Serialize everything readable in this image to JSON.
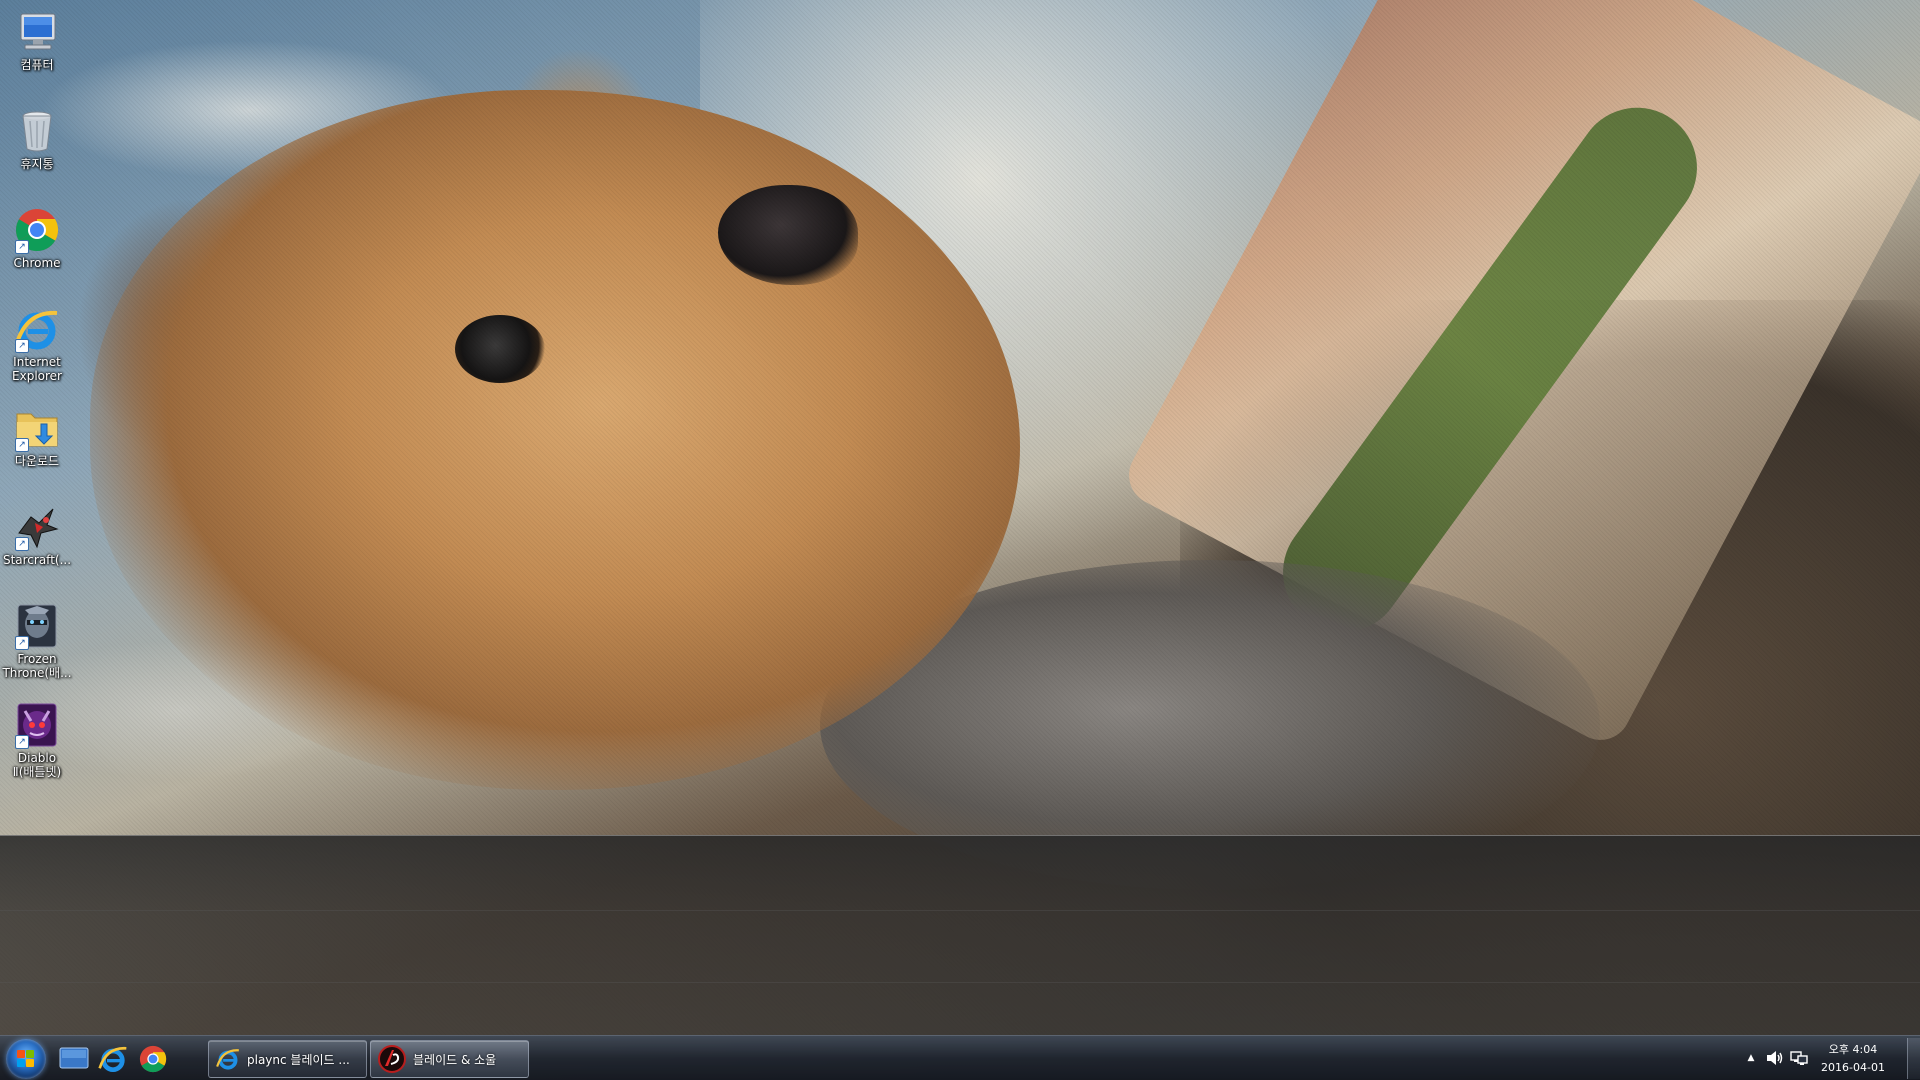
{
  "desktop": {
    "icons": [
      {
        "label": "컴퓨터",
        "icon": "computer-icon",
        "shortcut": false
      },
      {
        "label": "휴지통",
        "icon": "recycle-bin-icon",
        "shortcut": false
      },
      {
        "label": "Chrome",
        "icon": "chrome-icon",
        "shortcut": true
      },
      {
        "label": "Internet Explorer",
        "icon": "internet-explorer-icon",
        "shortcut": true
      },
      {
        "label": "다운로드",
        "icon": "downloads-folder-icon",
        "shortcut": true
      },
      {
        "label": "Starcraft(...",
        "icon": "starcraft-icon",
        "shortcut": true
      },
      {
        "label": "Frozen Throne(배...",
        "icon": "frozen-throne-icon",
        "shortcut": true
      },
      {
        "label": "Diablo Ⅱ(배틀넷)",
        "icon": "diablo-icon",
        "shortcut": true
      }
    ]
  },
  "taskbar": {
    "pinned": [
      {
        "name": "show-desktop-pin",
        "icon": "desktop-icon"
      },
      {
        "name": "internet-explorer-pin",
        "icon": "internet-explorer-icon"
      },
      {
        "name": "chrome-pin",
        "icon": "chrome-icon"
      }
    ],
    "windows": [
      {
        "label": "plaync 블레이드 ...",
        "icon": "internet-explorer-icon",
        "active": false
      },
      {
        "label": "블레이드 & 소울",
        "icon": "blade-and-soul-icon",
        "active": true
      }
    ],
    "tray": {
      "show_hidden_glyph": "▲",
      "volume_icon": "speaker-icon",
      "network_icon": "network-icon"
    },
    "clock": {
      "time": "오후 4:04",
      "date": "2016-04-01"
    }
  },
  "colors": {
    "taskbar_bg": "#1e2430",
    "ie_blue": "#1e90e6",
    "chrome_red": "#db4437",
    "chrome_yellow": "#f4c20d",
    "chrome_green": "#0f9d58",
    "chrome_blue": "#4285f4"
  }
}
